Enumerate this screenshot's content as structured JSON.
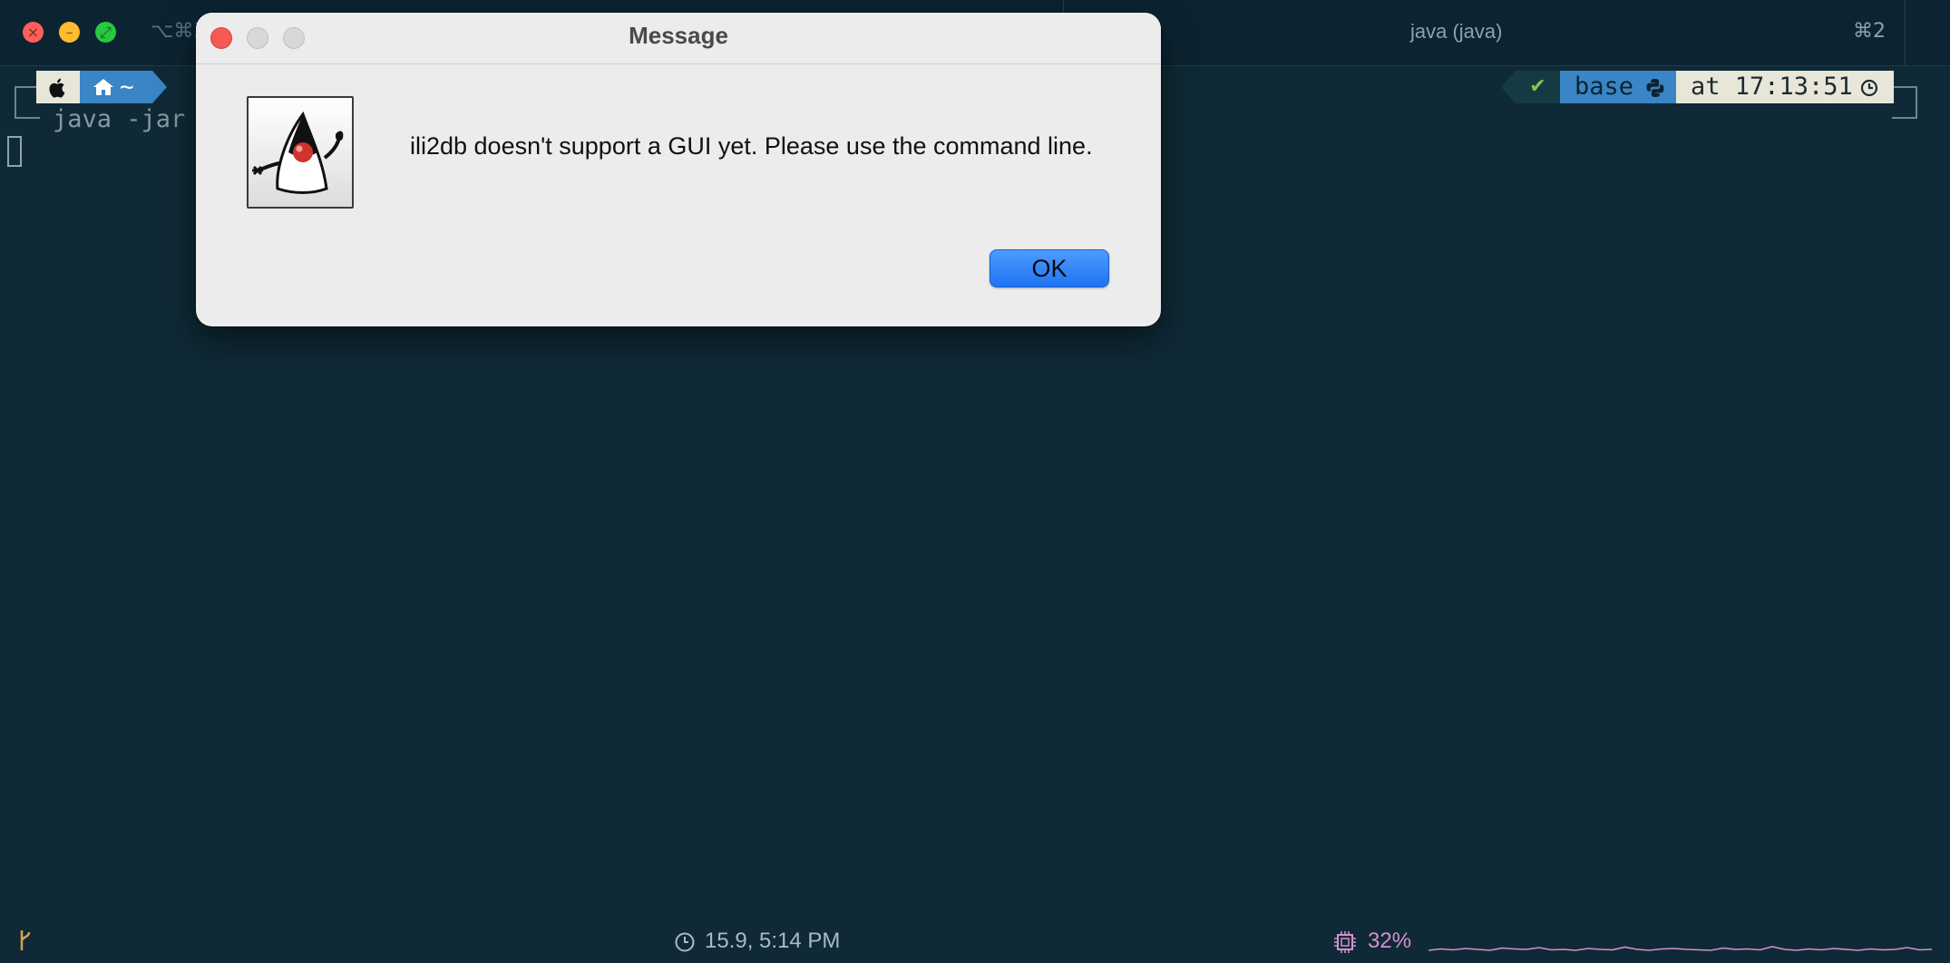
{
  "terminal": {
    "left_tab_shortcut": "⌥⌘3",
    "tab_title": "java (java)",
    "tab_shortcut": "⌘2"
  },
  "prompt": {
    "dir": "~",
    "command": "java -jar",
    "status_mark": "✔",
    "env": "base",
    "time": "at 17:13:51"
  },
  "status_bar": {
    "datetime": "15.9, 5:14 PM",
    "cpu": "32%",
    "cpu_history": [
      0.2,
      0.35,
      0.25,
      0.4,
      0.3,
      0.2,
      0.45,
      0.35,
      0.3,
      0.5,
      0.25,
      0.3,
      0.2,
      0.4,
      0.3,
      0.25,
      0.55,
      0.3,
      0.2,
      0.35,
      0.4,
      0.3,
      0.25,
      0.2,
      0.45,
      0.3,
      0.35,
      0.25,
      0.6,
      0.3,
      0.2,
      0.35,
      0.25,
      0.4,
      0.3,
      0.2,
      0.35,
      0.25,
      0.3,
      0.5,
      0.25,
      0.3
    ]
  },
  "dialog": {
    "title": "Message",
    "message": "ili2db doesn't support a GUI yet. Please use the command line.",
    "ok_label": "OK"
  },
  "colors": {
    "terminal_bg": "#0f2a36",
    "accent_blue": "#3a85c6",
    "ok_button": "#1f74f2",
    "cpu_text": "#d58fd0"
  }
}
